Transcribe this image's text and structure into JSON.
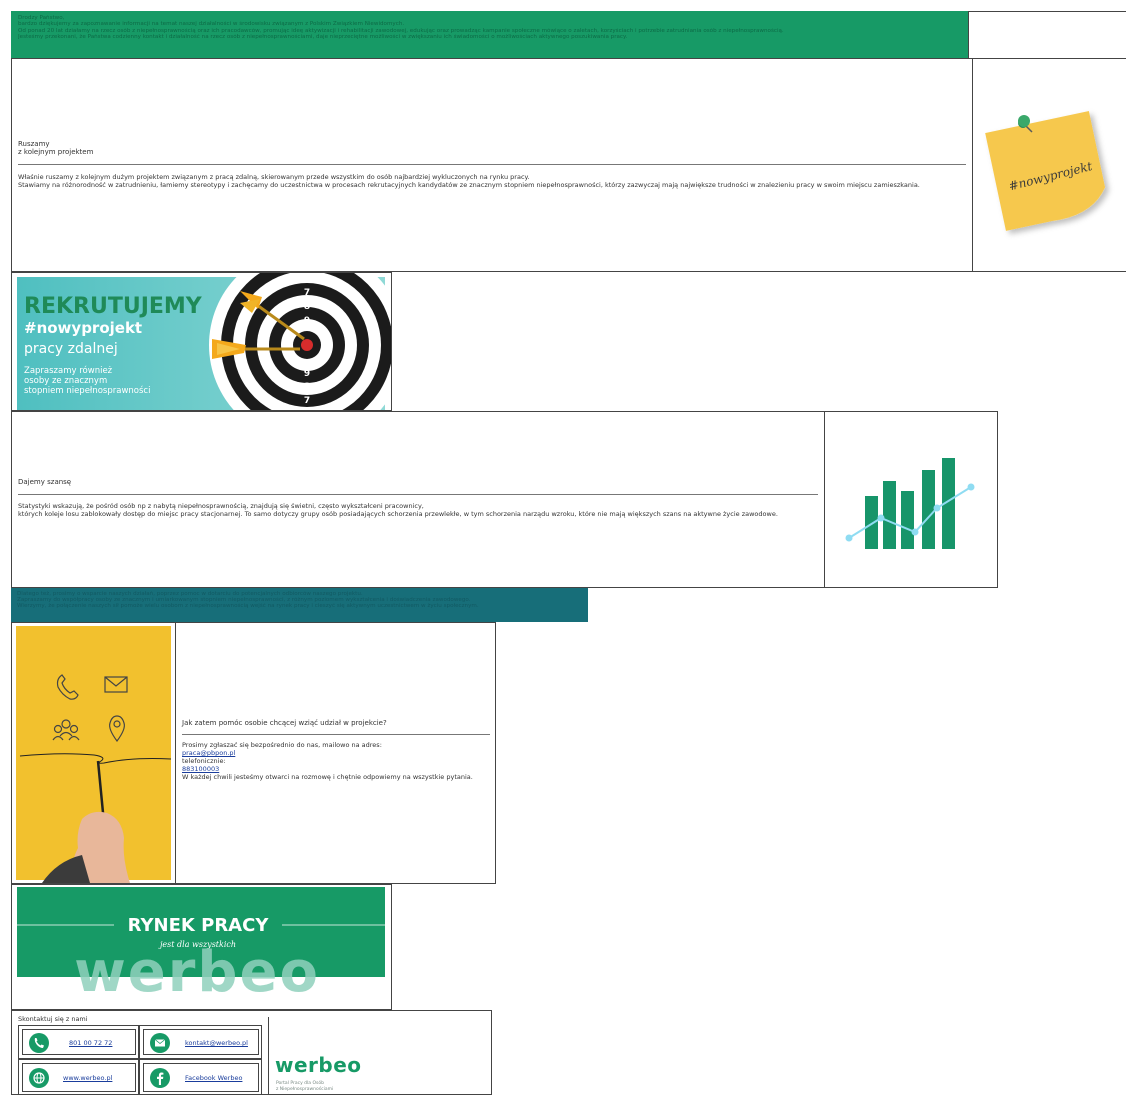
{
  "intro": {
    "greeting": "Drodzy Państwo,",
    "line1": "bardzo dziękujemy za zapoznawanie informacji na temat naszej działalności w środowisku związanym z Polskim Związkiem Niewidomych.",
    "line2": "Od ponad 20 lat działamy na rzecz osób z niepełnosprawnością oraz ich pracodawców, promując ideę aktywizacji i rehabilitacji zawodowej, edukując oraz prowadząc kampanie społeczne mówiące o zaletach, korzyściach i potrzebie zatrudniania osób z niepełnosprawnością.",
    "line3": "Jesteśmy przekonani, że Państwa codzienny kontakt i działalność na rzecz osób z niepełnosprawnościami, daje nieprzeciętne możliwości w zwiększaniu ich świadomości o możliwościach aktywnego poszukiwania pracy."
  },
  "section1": {
    "title_line1": "Ruszamy",
    "title_line2": "z kolejnym projektem",
    "body_line1": "Właśnie ruszamy z kolejnym dużym projektem związanym z pracą zdalną, skierowanym przede wszystkim do osób najbardziej wykluczonych na rynku pracy.",
    "body_line2": "Stawiamy na różnorodność w zatrudnieniu, łamiemy stereotypy i zachęcamy do uczestnictwa w procesach rekrutacyjnych kandydatów ze znacznym stopniem niepełnosprawności, którzy zazwyczaj mają największe trudności w znalezieniu pracy w swoim miejscu zamieszkania.",
    "note_text": "#nowyprojekt"
  },
  "banner1": {
    "title": "REKRUTUJEMY",
    "hashtag": "#nowyprojekt",
    "subtitle": "pracy zdalnej",
    "line1": "Zapraszamy również",
    "line2": "osoby ze znacznym",
    "line3": "stopniem niepełnosprawności",
    "target_numbers": [
      "6",
      "7",
      "8",
      "9",
      "9",
      "8",
      "7"
    ]
  },
  "section2": {
    "title": "Dajemy szansę",
    "body_line1": "Statystyki wskazują, że pośród osób np z nabytą niepełnosprawnością, znajdują się świetni, często wykształceni pracownicy,",
    "body_line2": "których koleje losu zablokowały dostęp do miejsc pracy stacjonarnej. To samo dotyczy grupy osób posiadających schorzenia przewlekłe, w tym schorzenia narządu wzroku, które nie mają większych szans na aktywne życie zawodowe."
  },
  "outro": {
    "line1": "Dlatego też, prosimy o wsparcie naszych działań, poprzez pomoc w dotarciu do potencjalnych odbiorców naszego projektu.",
    "line2": "Zapraszamy do współpracy osoby ze znacznym i umiarkowanym stopniem niepełnosprawności, z różnym poziomem wykształcenia i doświadczenia zawodowego.",
    "line3": "Wierzymy, że połączenie naszych sił pomoże wielu osobom z niepełnosprawnością wejść na rynek pracy i cieszyć się aktywnym uczestnictwem w życiu społecznym."
  },
  "section3": {
    "title": "Jak zatem pomóc osobie chcącej wziąć udział w projekcie?",
    "body_line1": "Prosimy zgłaszać się bezpośrednio do nas, mailowo na adres:",
    "email": "praca@pbpon.pl",
    "phone_label": "telefonicznie:",
    "phone": "883100003",
    "body_line2": "W każdej chwili jesteśmy otwarci na rozmowę i chętnie odpowiemy na wszystkie pytania."
  },
  "banner2": {
    "title": "RYNEK PRACY",
    "subtitle": "jest dla wszystkich",
    "brand": "werbeo"
  },
  "contact": {
    "heading": "Skontaktuj się z nami",
    "phone": "801 00 72 72",
    "email": "kontakt@werbeo.pl",
    "website": "www.werbeo.pl",
    "facebook": "Facebook Werbeo",
    "logo_name": "werbeo",
    "logo_tag1": "Portal Pracy dla Osób",
    "logo_tag2": "z Niepełnosprawnościami"
  },
  "colors": {
    "green": "#179a66",
    "teal": "#176e79",
    "yellow": "#f2c12e",
    "banner_teal": "#5ac4c2"
  }
}
